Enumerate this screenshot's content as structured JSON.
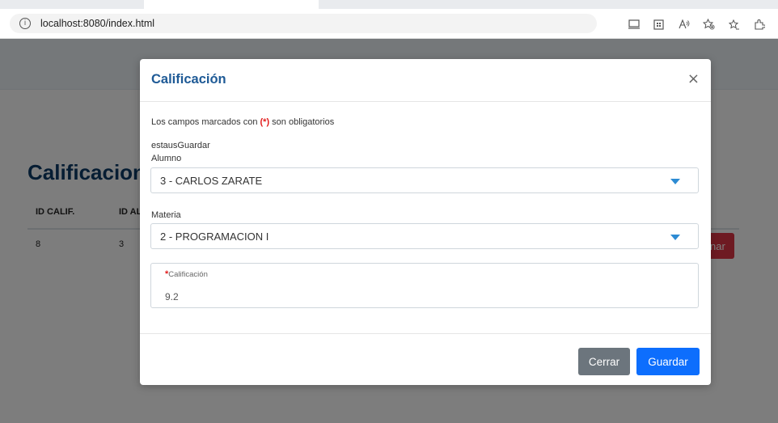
{
  "browser": {
    "url": "localhost:8080/index.html",
    "info_glyph": "i"
  },
  "background_page": {
    "title": "Calificacion",
    "columns": [
      "ID CALIF.",
      "ID AL"
    ],
    "rows": [
      [
        "8",
        "3"
      ]
    ],
    "action_button_label": "nar"
  },
  "modal": {
    "title": "Calificación",
    "close_glyph": "×",
    "required_note_prefix": "Los campos marcados con ",
    "required_note_marker": "(*)",
    "required_note_suffix": " son obligatorios",
    "status_text": "estausGuardar",
    "alumno": {
      "label": "Alumno",
      "value": "3 - CARLOS ZARATE"
    },
    "materia": {
      "label": "Materia",
      "value": "2 - PROGRAMACION I"
    },
    "calificacion": {
      "required_marker": "*",
      "label": "Calificación",
      "value": "9.2"
    },
    "buttons": {
      "close": "Cerrar",
      "save": "Guardar"
    }
  },
  "colors": {
    "title_blue": "#1e5a96",
    "required_red": "#e21b1b",
    "primary": "#0d6efd",
    "secondary": "#6c757d",
    "danger": "#dc3545"
  }
}
